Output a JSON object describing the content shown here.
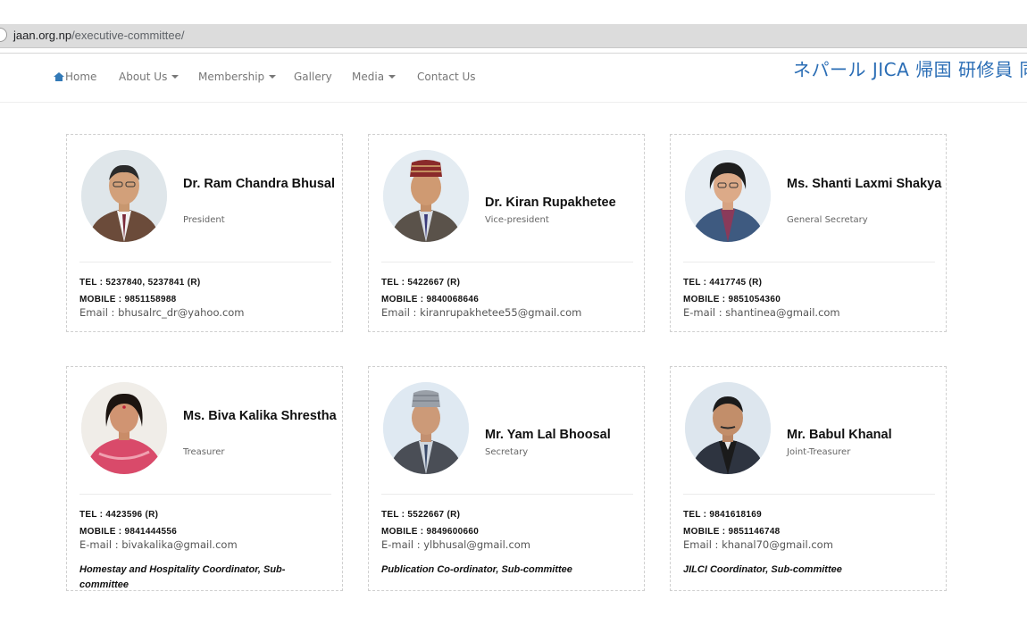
{
  "browser": {
    "url_domain": "jaan.org.np",
    "url_path": "/executive-committee/"
  },
  "nav": {
    "items": [
      {
        "label": "Home",
        "icon": "home-icon"
      },
      {
        "label": "About Us",
        "dropdown": true
      },
      {
        "label": "Membership",
        "dropdown": true
      },
      {
        "label": "Gallery"
      },
      {
        "label": "Media",
        "dropdown": true
      },
      {
        "label": "Contact Us"
      }
    ],
    "banner_text": "ネパール JICA 帰国 研修員 同窓"
  },
  "colors": {
    "accent": "#337ab7",
    "banner": "#2a6db5",
    "nav_text": "#777777"
  },
  "members": [
    {
      "name": "Dr. Ram Chandra Bhusal",
      "role": "President",
      "tel": "TEL : 5237840, 5237841 (R)",
      "mobile": "MOBILE : 9851158988",
      "email": "Email : bhusalrc_dr@yahoo.com",
      "committee": ""
    },
    {
      "name": "Dr. Kiran Rupakhetee",
      "role": "Vice-president",
      "tel": "TEL : 5422667 (R)",
      "mobile": "MOBILE : 9840068646",
      "email": "Email : kiranrupakhetee55@gmail.com",
      "committee": ""
    },
    {
      "name": "Ms. Shanti Laxmi Shakya",
      "role": "General Secretary",
      "tel": "TEL : 4417745 (R)",
      "mobile": "MOBILE : 9851054360",
      "email": "E-mail : shantinea@gmail.com",
      "committee": ""
    },
    {
      "name": "Ms. Biva Kalika Shrestha",
      "role": "Treasurer",
      "tel": "TEL : 4423596 (R)",
      "mobile": "MOBILE : 9841444556",
      "email": "E-mail : bivakalika@gmail.com",
      "committee": "Homestay and Hospitality Coordinator, Sub-committee"
    },
    {
      "name": "Mr. Yam Lal Bhoosal",
      "role": "Secretary",
      "tel": "TEL : 5522667 (R)",
      "mobile": "MOBILE : 9849600660",
      "email": "E-mail : ylbhusal@gmail.com",
      "committee": "Publication Co-ordinator, Sub-committee"
    },
    {
      "name": "Mr. Babul Khanal",
      "role": "Joint-Treasurer",
      "tel": "TEL : 9841618169",
      "mobile": "MOBILE : 9851146748",
      "email": "Email : khanal70@gmail.com",
      "committee": "JILCI Coordinator, Sub-committee"
    }
  ]
}
